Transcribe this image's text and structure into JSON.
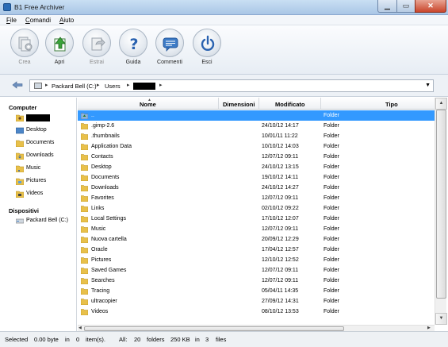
{
  "window": {
    "title": "B1 Free Archiver"
  },
  "menu": [
    "File",
    "Comandi",
    "Aiuto"
  ],
  "toolbar": [
    {
      "label": "Crea",
      "icon": "create-archive-icon",
      "enabled": false
    },
    {
      "label": "Apri",
      "icon": "open-archive-icon",
      "enabled": true
    },
    {
      "label": "Estrai",
      "icon": "extract-icon",
      "enabled": false
    },
    {
      "label": "Guida",
      "icon": "help-icon",
      "enabled": true
    },
    {
      "label": "Commenti",
      "icon": "comments-icon",
      "enabled": true
    },
    {
      "label": "Esci",
      "icon": "power-icon",
      "enabled": true
    }
  ],
  "address": {
    "drive": "Packard Bell (C:)",
    "folder": "Users"
  },
  "sidebar": {
    "computer_label": "Computer",
    "computer_items": [
      "Desktop",
      "Documents",
      "Downloads",
      "Music",
      "Pictures",
      "Videos"
    ],
    "devices_label": "Dispositivi",
    "device_items": [
      "Packard Bell (C:)"
    ]
  },
  "columns": {
    "name": "Nome",
    "size": "Dimensioni",
    "modified": "Modificato",
    "type": "Tipo"
  },
  "rows": [
    {
      "name": "..",
      "modified": "",
      "type": "Folder",
      "selected": true
    },
    {
      "name": ".gimp-2.6",
      "modified": "24/10/12 14:17",
      "type": "Folder"
    },
    {
      "name": ".thumbnails",
      "modified": "10/01/11 11:22",
      "type": "Folder"
    },
    {
      "name": "Application Data",
      "modified": "10/10/12 14:03",
      "type": "Folder"
    },
    {
      "name": "Contacts",
      "modified": "12/07/12 09:11",
      "type": "Folder"
    },
    {
      "name": "Desktop",
      "modified": "24/10/12 13:15",
      "type": "Folder"
    },
    {
      "name": "Documents",
      "modified": "19/10/12 14:11",
      "type": "Folder"
    },
    {
      "name": "Downloads",
      "modified": "24/10/12 14:27",
      "type": "Folder"
    },
    {
      "name": "Favorites",
      "modified": "12/07/12 09:11",
      "type": "Folder"
    },
    {
      "name": "Links",
      "modified": "02/10/12 09:22",
      "type": "Folder"
    },
    {
      "name": "Local Settings",
      "modified": "17/10/12 12:07",
      "type": "Folder"
    },
    {
      "name": "Music",
      "modified": "12/07/12 09:11",
      "type": "Folder"
    },
    {
      "name": "Nuova cartella",
      "modified": "20/09/12 12:29",
      "type": "Folder"
    },
    {
      "name": "Oracle",
      "modified": "17/04/12 12:57",
      "type": "Folder"
    },
    {
      "name": "Pictures",
      "modified": "12/10/12 12:52",
      "type": "Folder"
    },
    {
      "name": "Saved Games",
      "modified": "12/07/12 09:11",
      "type": "Folder"
    },
    {
      "name": "Searches",
      "modified": "12/07/12 09:11",
      "type": "Folder"
    },
    {
      "name": "Tracing",
      "modified": "05/04/11 14:35",
      "type": "Folder"
    },
    {
      "name": "ultracopier",
      "modified": "27/09/12 14:31",
      "type": "Folder"
    },
    {
      "name": "Videos",
      "modified": "08/10/12 13:53",
      "type": "Folder"
    }
  ],
  "status": {
    "selected_label": "Selected",
    "selected_size": "0.00 byte",
    "in_word": "in",
    "selected_count": "0",
    "items_label": "item(s).",
    "all_label": "All:",
    "folders_count": "20",
    "folders_label": "folders",
    "total_size": "250 KB",
    "in_word2": "in",
    "files_count": "3",
    "files_label": "files"
  },
  "colors": {
    "selection": "#3399ff",
    "folder": "#e8c04a"
  }
}
